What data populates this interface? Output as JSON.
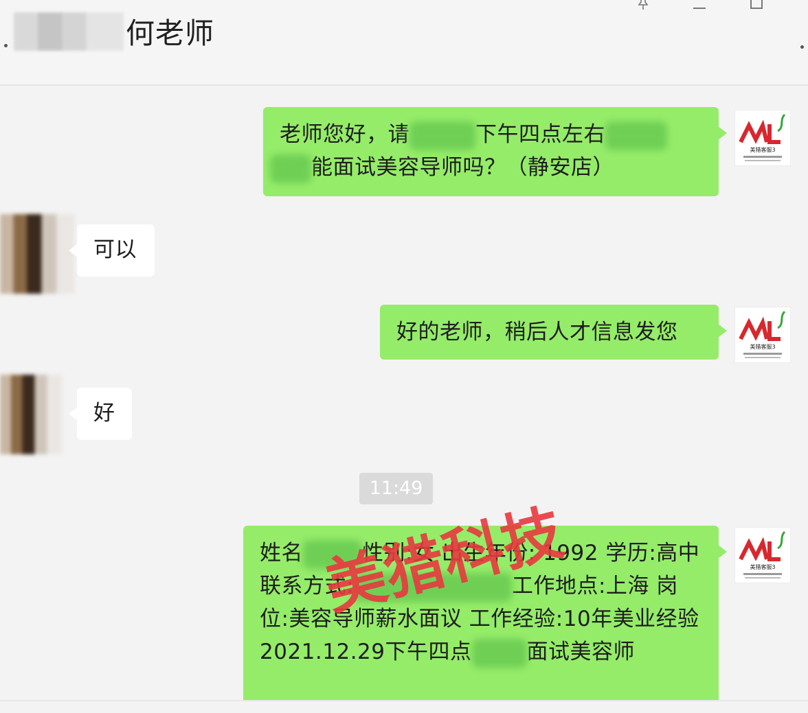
{
  "header": {
    "title": "何老师",
    "pin_icon": "pin-icon",
    "minimize_icon": "minimize-icon",
    "maximize_icon": "maximize-icon"
  },
  "messages": [
    {
      "direction": "out",
      "parts": [
        "老师您好，请",
        "下午四点左右",
        "能面试美容导师吗？（静安店）"
      ]
    },
    {
      "direction": "in",
      "text": "可以"
    },
    {
      "direction": "out",
      "text": "好的老师，稍后人才信息发您"
    },
    {
      "direction": "in",
      "text": "好"
    },
    {
      "direction": "out",
      "parts": [
        "姓名",
        "性别:女 出生年份: 1992 学历:高中 联系方式:",
        "工作地点:上海 岗位:美容导师薪水面议 工作经验:10年美业经验 2021.12.29下午四点",
        "面试美容师"
      ]
    }
  ],
  "timestamp": "11:49",
  "avatar_logo": {
    "mark": "ML",
    "caption": "美猎客服3",
    "colors": {
      "red": "#d6282e",
      "green": "#3aa53a"
    }
  },
  "watermark": "美猎科技",
  "colors": {
    "out_bubble": "#95ec69",
    "in_bubble": "#ffffff",
    "background": "#f3f3f3",
    "watermark": "#e8393f"
  }
}
